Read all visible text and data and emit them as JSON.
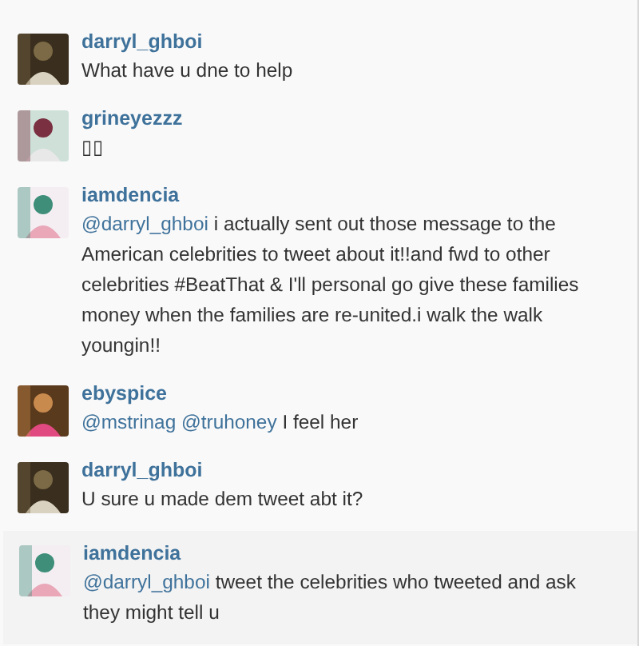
{
  "comments": [
    {
      "username": "darryl_ghboi",
      "avatar": {
        "kind": "picture"
      },
      "highlighted": false,
      "body": [
        {
          "kind": "text",
          "text": "What have u dne to help"
        }
      ]
    },
    {
      "username": "grineyezzz",
      "avatar": {
        "kind": "picture"
      },
      "highlighted": false,
      "body": [
        {
          "kind": "text",
          "text": "▯▯"
        }
      ]
    },
    {
      "username": "iamdencia",
      "avatar": {
        "kind": "picture"
      },
      "highlighted": false,
      "body": [
        {
          "kind": "mention",
          "text": "@darryl_ghboi"
        },
        {
          "kind": "text",
          "text": "i actually sent out those message to the American celebrities to tweet about it!!and fwd to other celebrities #BeatThat & I'll personal go give these families money when the families are re-united.i walk the walk youngin!!"
        }
      ]
    },
    {
      "username": "ebyspice",
      "avatar": {
        "kind": "picture"
      },
      "highlighted": false,
      "body": [
        {
          "kind": "mention",
          "text": "@mstrinag"
        },
        {
          "kind": "mention",
          "text": "@truhoney"
        },
        {
          "kind": "text",
          "text": "I feel her"
        }
      ]
    },
    {
      "username": "darryl_ghboi",
      "avatar": {
        "kind": "picture"
      },
      "highlighted": false,
      "body": [
        {
          "kind": "text",
          "text": "U sure u made dem tweet abt it?"
        }
      ]
    },
    {
      "username": "iamdencia",
      "avatar": {
        "kind": "picture"
      },
      "highlighted": true,
      "body": [
        {
          "kind": "mention",
          "text": "@darryl_ghboi"
        },
        {
          "kind": "text",
          "text": "tweet the celebrities who tweeted and ask they might tell u"
        }
      ]
    }
  ]
}
